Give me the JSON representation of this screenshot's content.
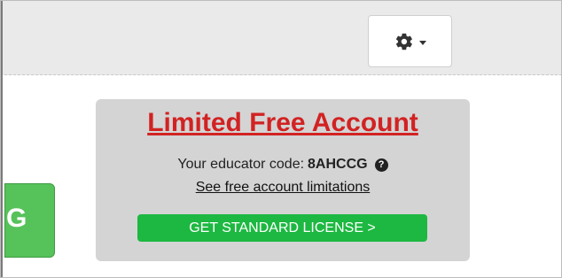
{
  "toolbar": {
    "settings_icon": "gear-icon",
    "settings_caret_icon": "chevron-down-icon"
  },
  "side_button": {
    "label": "G",
    "color": "#56c25a"
  },
  "account_card": {
    "title": "Limited Free Account",
    "educator_code_label": "Your educator code:",
    "educator_code": "8AHCCG",
    "help_icon_glyph": "?",
    "limitations_link": "See free account limitations",
    "license_button": "GET STANDARD LICENSE >",
    "title_color": "#d22222",
    "button_color": "#1db841"
  }
}
